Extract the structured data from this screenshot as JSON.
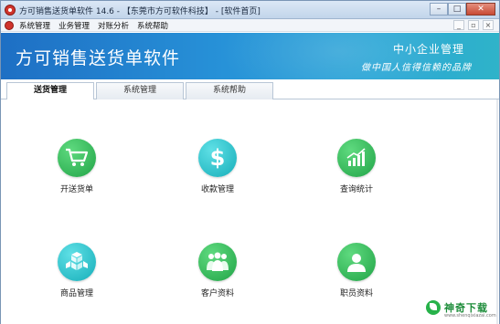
{
  "window": {
    "title": "方可销售送货单软件 14.6 - 【东莞市方可软件科技】 - [软件首页]",
    "controls": {
      "minimize": "–",
      "maximize": "□",
      "close": "✕"
    }
  },
  "menubar": {
    "items": [
      "系统管理",
      "业务管理",
      "对账分析",
      "系统帮助"
    ],
    "mdi_controls": {
      "minimize": "_",
      "restore": "▫",
      "close": "×"
    }
  },
  "banner": {
    "title": "方可销售送货单软件",
    "slogan_line1": "中小企业管理",
    "slogan_line2": "做中国人信得信赖的品牌"
  },
  "tabs": [
    {
      "label": "送货管理",
      "active": true
    },
    {
      "label": "系统管理",
      "active": false
    },
    {
      "label": "系统帮助",
      "active": false
    }
  ],
  "tiles": [
    {
      "label": "开送货单",
      "icon": "shopping-cart-icon",
      "color": "#2dbe5a"
    },
    {
      "label": "收款管理",
      "icon": "dollar-icon",
      "color": "#1fb8c4"
    },
    {
      "label": "查询统计",
      "icon": "chart-icon",
      "color": "#2dbe5a"
    },
    {
      "label": "商品管理",
      "icon": "boxes-icon",
      "color": "#1fb8c4"
    },
    {
      "label": "客户资料",
      "icon": "customers-icon",
      "color": "#2dbe5a"
    },
    {
      "label": "职员资料",
      "icon": "employee-icon",
      "color": "#2dbe5a"
    }
  ],
  "watermark": {
    "text": "神奇下载",
    "sub": "www.shenqixiazai.com"
  }
}
